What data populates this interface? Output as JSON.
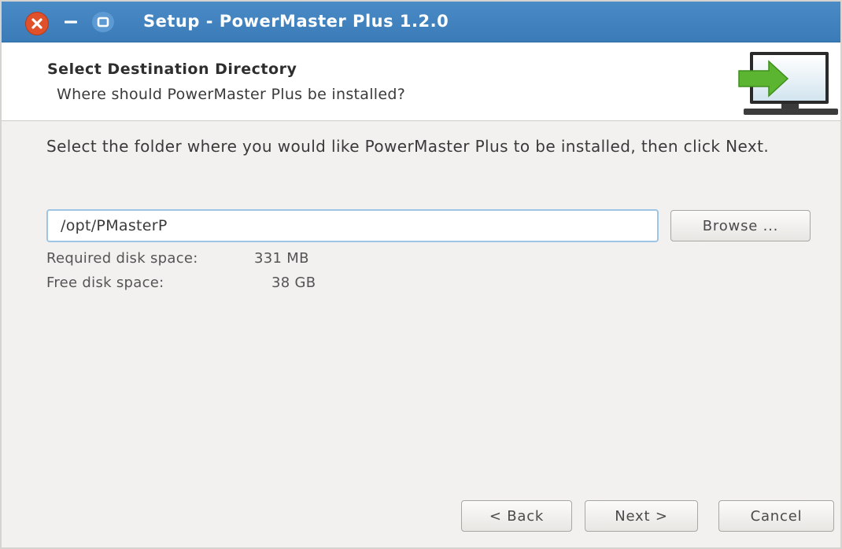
{
  "window": {
    "title": "Setup - PowerMaster Plus 1.2.0",
    "controls": {
      "close": "close-icon",
      "minimize": "minimize-icon",
      "maximize": "maximize-icon"
    },
    "accent_color": "#3a7bb8"
  },
  "header": {
    "title": "Select Destination Directory",
    "subtitle": "Where should PowerMaster Plus be installed?",
    "icon": "install-computer-icon"
  },
  "content": {
    "instruction": "Select the folder where you would like PowerMaster Plus to be installed, then click Next.",
    "path_value": "/opt/PMasterP",
    "browse_label": "Browse ...",
    "required_label": "Required disk space:",
    "required_value": "331 MB",
    "free_label": "Free disk space:",
    "free_value": "38 GB"
  },
  "footer": {
    "back_label": "< Back",
    "next_label": "Next >",
    "cancel_label": "Cancel"
  }
}
